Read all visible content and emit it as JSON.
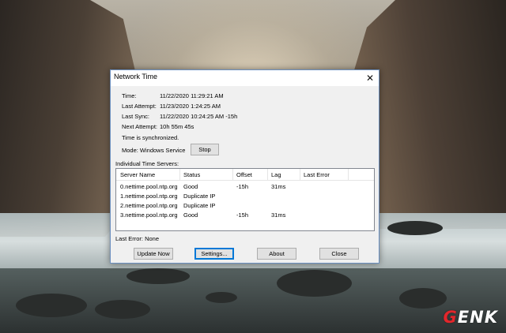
{
  "window": {
    "title": "Network Time",
    "close_glyph": "✕"
  },
  "info": {
    "time_label": "Time:",
    "time_value": "11/22/2020 11:29:21 AM",
    "last_attempt_label": "Last Attempt:",
    "last_attempt_value": "11/23/2020 1:24:25 AM",
    "last_sync_label": "Last Sync:",
    "last_sync_value": "11/22/2020 10:24:25 AM -15h",
    "next_attempt_label": "Next Attempt:",
    "next_attempt_value": "10h 55m 45s",
    "status_text": "Time is synchronized.",
    "mode_text": "Mode: Windows Service",
    "stop_label": "Stop"
  },
  "servers": {
    "section_label": "Individual Time Servers:",
    "columns": [
      "Server Name",
      "Status",
      "Offset",
      "Lag",
      "Last Error"
    ],
    "rows": [
      {
        "name": "0.nettime.pool.ntp.org",
        "status": "Good",
        "offset": "-15h",
        "lag": "31ms",
        "error": ""
      },
      {
        "name": "1.nettime.pool.ntp.org",
        "status": "Duplicate IP",
        "offset": "",
        "lag": "",
        "error": ""
      },
      {
        "name": "2.nettime.pool.ntp.org",
        "status": "Duplicate IP",
        "offset": "",
        "lag": "",
        "error": ""
      },
      {
        "name": "3.nettime.pool.ntp.org",
        "status": "Good",
        "offset": "-15h",
        "lag": "31ms",
        "error": ""
      }
    ]
  },
  "footer": {
    "last_error_text": "Last Error:  None",
    "update_now_label": "Update Now",
    "settings_label": "Settings...",
    "about_label": "About",
    "close_label": "Close"
  },
  "watermark": {
    "logo_text": "GENK"
  }
}
